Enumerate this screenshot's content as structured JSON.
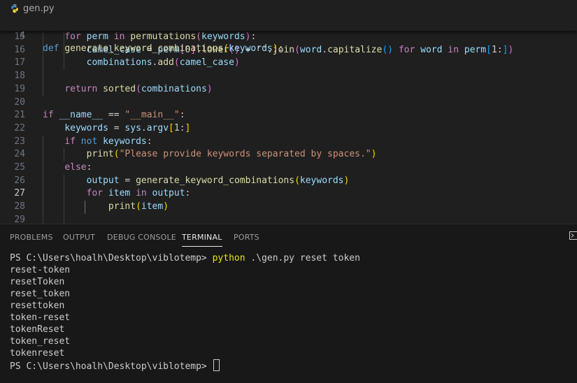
{
  "breadcrumb": {
    "file_name": "gen.py",
    "icon": "python-icon"
  },
  "editor": {
    "active_line": "27",
    "sticky": {
      "line": "4",
      "tokens": [
        {
          "t": "def",
          "c": "kw"
        },
        {
          "t": " ",
          "c": "pl"
        },
        {
          "t": "generate_keyword_combinations",
          "c": "fn"
        },
        {
          "t": "(",
          "c": "b1"
        },
        {
          "t": "keywords",
          "c": "vr"
        },
        {
          "t": ")",
          "c": "b1"
        },
        {
          "t": ":",
          "c": "pl"
        }
      ]
    },
    "lines": [
      {
        "n": "15",
        "tokens": [
          {
            "t": "    ",
            "c": "pl"
          },
          {
            "t": "for",
            "c": "ctl"
          },
          {
            "t": " perm ",
            "c": "vr"
          },
          {
            "t": "in",
            "c": "ctl"
          },
          {
            "t": " ",
            "c": "pl"
          },
          {
            "t": "permutations",
            "c": "fn"
          },
          {
            "t": "(",
            "c": "b2"
          },
          {
            "t": "keywords",
            "c": "vr"
          },
          {
            "t": ")",
            "c": "b2"
          },
          {
            "t": ":",
            "c": "pl"
          }
        ]
      },
      {
        "n": "16",
        "tokens": [
          {
            "t": "        ",
            "c": "pl"
          },
          {
            "t": "camel_case",
            "c": "vr"
          },
          {
            "t": " = ",
            "c": "pl"
          },
          {
            "t": "perm",
            "c": "vr"
          },
          {
            "t": "[",
            "c": "b2"
          },
          {
            "t": "0",
            "c": "pl"
          },
          {
            "t": "]",
            "c": "b2"
          },
          {
            "t": ".",
            "c": "pl"
          },
          {
            "t": "lower",
            "c": "fn"
          },
          {
            "t": "()",
            "c": "b2"
          },
          {
            "t": " + ",
            "c": "pl"
          },
          {
            "t": "''",
            "c": "st"
          },
          {
            "t": ".",
            "c": "pl"
          },
          {
            "t": "join",
            "c": "fn"
          },
          {
            "t": "(",
            "c": "b2"
          },
          {
            "t": "word",
            "c": "vr"
          },
          {
            "t": ".",
            "c": "pl"
          },
          {
            "t": "capitalize",
            "c": "fn"
          },
          {
            "t": "()",
            "c": "b3"
          },
          {
            "t": " ",
            "c": "pl"
          },
          {
            "t": "for",
            "c": "ctl"
          },
          {
            "t": " word ",
            "c": "vr"
          },
          {
            "t": "in",
            "c": "ctl"
          },
          {
            "t": " perm",
            "c": "vr"
          },
          {
            "t": "[",
            "c": "b3"
          },
          {
            "t": "1:",
            "c": "pl"
          },
          {
            "t": "]",
            "c": "b3"
          },
          {
            "t": ")",
            "c": "b2"
          }
        ]
      },
      {
        "n": "17",
        "tokens": [
          {
            "t": "        ",
            "c": "pl"
          },
          {
            "t": "combinations",
            "c": "vr"
          },
          {
            "t": ".",
            "c": "pl"
          },
          {
            "t": "add",
            "c": "fn"
          },
          {
            "t": "(",
            "c": "b2"
          },
          {
            "t": "camel_case",
            "c": "vr"
          },
          {
            "t": ")",
            "c": "b2"
          }
        ]
      },
      {
        "n": "18",
        "tokens": []
      },
      {
        "n": "19",
        "tokens": [
          {
            "t": "    ",
            "c": "pl"
          },
          {
            "t": "return",
            "c": "ctl"
          },
          {
            "t": " ",
            "c": "pl"
          },
          {
            "t": "sorted",
            "c": "fn"
          },
          {
            "t": "(",
            "c": "b2"
          },
          {
            "t": "combinations",
            "c": "vr"
          },
          {
            "t": ")",
            "c": "b2"
          }
        ]
      },
      {
        "n": "20",
        "tokens": []
      },
      {
        "n": "21",
        "tokens": [
          {
            "t": "if",
            "c": "ctl"
          },
          {
            "t": " ",
            "c": "pl"
          },
          {
            "t": "__name__",
            "c": "vr"
          },
          {
            "t": " == ",
            "c": "pl"
          },
          {
            "t": "\"__main__\"",
            "c": "st"
          },
          {
            "t": ":",
            "c": "pl"
          }
        ]
      },
      {
        "n": "22",
        "tokens": [
          {
            "t": "    ",
            "c": "pl"
          },
          {
            "t": "keywords",
            "c": "vr"
          },
          {
            "t": " = ",
            "c": "pl"
          },
          {
            "t": "sys",
            "c": "vr"
          },
          {
            "t": ".",
            "c": "pl"
          },
          {
            "t": "argv",
            "c": "vr"
          },
          {
            "t": "[",
            "c": "b1"
          },
          {
            "t": "1:",
            "c": "pl"
          },
          {
            "t": "]",
            "c": "b1"
          }
        ]
      },
      {
        "n": "23",
        "tokens": [
          {
            "t": "    ",
            "c": "pl"
          },
          {
            "t": "if",
            "c": "ctl"
          },
          {
            "t": " ",
            "c": "pl"
          },
          {
            "t": "not",
            "c": "kw"
          },
          {
            "t": " keywords",
            "c": "vr"
          },
          {
            "t": ":",
            "c": "pl"
          }
        ]
      },
      {
        "n": "24",
        "tokens": [
          {
            "t": "        ",
            "c": "pl"
          },
          {
            "t": "print",
            "c": "fn"
          },
          {
            "t": "(",
            "c": "b1"
          },
          {
            "t": "\"Please provide keywords separated by spaces.\"",
            "c": "st"
          },
          {
            "t": ")",
            "c": "b1"
          }
        ]
      },
      {
        "n": "25",
        "tokens": [
          {
            "t": "    ",
            "c": "pl"
          },
          {
            "t": "else",
            "c": "ctl"
          },
          {
            "t": ":",
            "c": "pl"
          }
        ]
      },
      {
        "n": "26",
        "tokens": [
          {
            "t": "        ",
            "c": "pl"
          },
          {
            "t": "output",
            "c": "vr"
          },
          {
            "t": " = ",
            "c": "pl"
          },
          {
            "t": "generate_keyword_combinations",
            "c": "fn"
          },
          {
            "t": "(",
            "c": "b1"
          },
          {
            "t": "keywords",
            "c": "vr"
          },
          {
            "t": ")",
            "c": "b1"
          }
        ]
      },
      {
        "n": "27",
        "tokens": [
          {
            "t": "        ",
            "c": "pl"
          },
          {
            "t": "for",
            "c": "ctl"
          },
          {
            "t": " item ",
            "c": "vr"
          },
          {
            "t": "in",
            "c": "ctl"
          },
          {
            "t": " output",
            "c": "vr"
          },
          {
            "t": ":",
            "c": "pl"
          }
        ]
      },
      {
        "n": "28",
        "tokens": [
          {
            "t": "            ",
            "c": "pl"
          },
          {
            "t": "print",
            "c": "fn"
          },
          {
            "t": "(",
            "c": "b1"
          },
          {
            "t": "item",
            "c": "vr"
          },
          {
            "t": ")",
            "c": "b1"
          }
        ]
      },
      {
        "n": "29",
        "tokens": []
      }
    ]
  },
  "panel": {
    "tabs": [
      {
        "label": "PROBLEMS",
        "active": false
      },
      {
        "label": "OUTPUT",
        "active": false
      },
      {
        "label": "DEBUG CONSOLE",
        "active": false
      },
      {
        "label": "TERMINAL",
        "active": true
      },
      {
        "label": "PORTS",
        "active": false
      }
    ],
    "terminal_icon": "terminal-icon"
  },
  "terminal": {
    "prompt": "PS C:\\Users\\hoalh\\Desktop\\viblotemp> ",
    "command": "python",
    "args": " .\\gen.py reset token",
    "output": [
      "reset-token",
      "resetToken",
      "reset_token",
      "resettoken",
      "token-reset",
      "tokenReset",
      "token_reset",
      "tokenreset"
    ]
  },
  "colors": {
    "editor_bg": "#1f1f1f",
    "panel_bg": "#181818",
    "keyword": "#569cd6",
    "control": "#c586c0",
    "function": "#dcdcaa",
    "variable": "#9cdcfe",
    "string": "#ce9178",
    "command": "#e5e510"
  }
}
